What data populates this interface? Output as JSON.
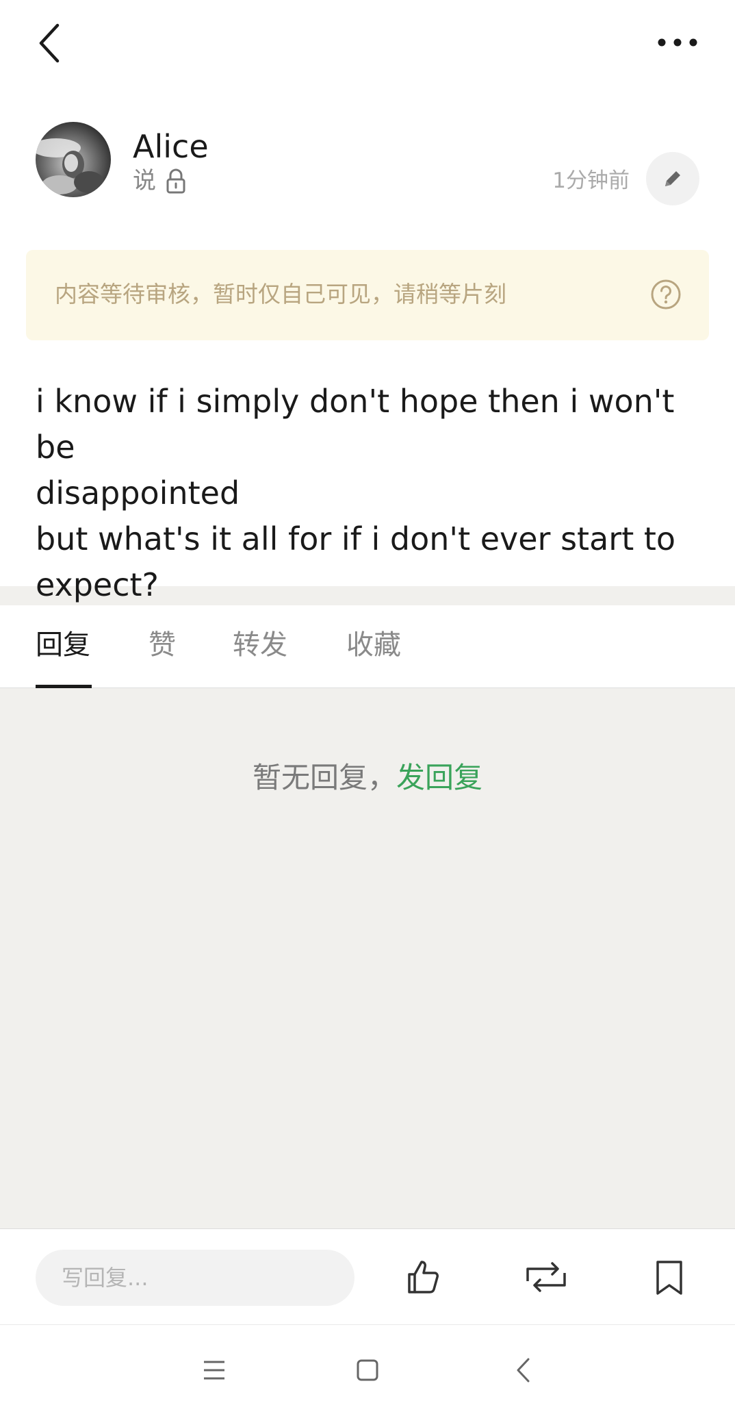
{
  "header": {
    "back_icon": "chevron-left-icon",
    "more_icon": "more-horizontal-icon"
  },
  "post": {
    "author": "Alice",
    "verb": "说",
    "lock_icon": "lock-icon",
    "time": "1分钟前",
    "edit_icon": "pencil-icon",
    "notice": "内容等待审核，暂时仅自己可见，请稍等片刻",
    "notice_icon": "question-circle-icon",
    "lines": [
      "i know if i simply don't hope then i won't be",
      "disappointed",
      "but what's it all for if i don't ever start to",
      "expect?"
    ]
  },
  "tabs": [
    {
      "label": "回复",
      "active": true
    },
    {
      "label": "赞",
      "active": false
    },
    {
      "label": "转发",
      "active": false
    },
    {
      "label": "收藏",
      "active": false
    }
  ],
  "empty": {
    "text": "暂无回复，",
    "link": "发回复"
  },
  "bottom_bar": {
    "reply_placeholder": "写回复...",
    "icons": [
      "thumbs-up-icon",
      "repost-icon",
      "bookmark-icon"
    ]
  },
  "system_nav": {
    "icons": [
      "menu-icon",
      "home-icon",
      "back-icon"
    ]
  },
  "colors": {
    "accent_green": "#3aa35a",
    "notice_bg": "#fcf8e6",
    "notice_text": "#b8a580",
    "page_bg": "#f1f0ed"
  }
}
